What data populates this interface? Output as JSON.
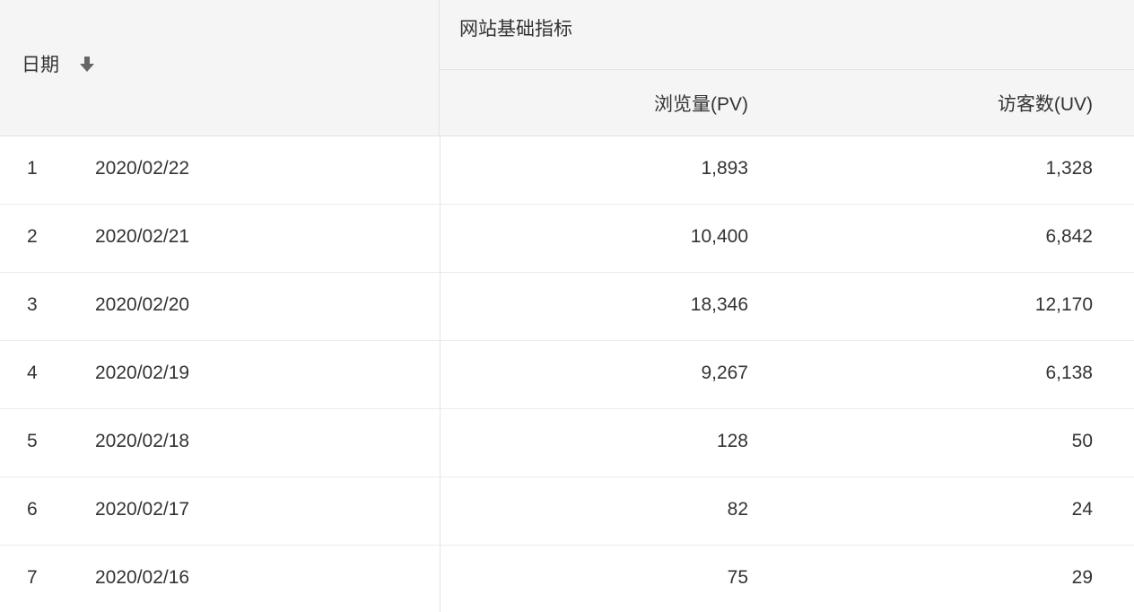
{
  "header": {
    "date_label": "日期",
    "group_label": "网站基础指标",
    "pv_label": "浏览量(PV)",
    "uv_label": "访客数(UV)",
    "sort_icon": "arrow-down-icon"
  },
  "rows": [
    {
      "index": "1",
      "date": "2020/02/22",
      "pv": "1,893",
      "uv": "1,328"
    },
    {
      "index": "2",
      "date": "2020/02/21",
      "pv": "10,400",
      "uv": "6,842"
    },
    {
      "index": "3",
      "date": "2020/02/20",
      "pv": "18,346",
      "uv": "12,170"
    },
    {
      "index": "4",
      "date": "2020/02/19",
      "pv": "9,267",
      "uv": "6,138"
    },
    {
      "index": "5",
      "date": "2020/02/18",
      "pv": "128",
      "uv": "50"
    },
    {
      "index": "6",
      "date": "2020/02/17",
      "pv": "82",
      "uv": "24"
    },
    {
      "index": "7",
      "date": "2020/02/16",
      "pv": "75",
      "uv": "29"
    }
  ],
  "colors": {
    "header_bg": "#f5f5f5",
    "text": "#333333",
    "border": "#e3e3e3",
    "icon": "#666666"
  }
}
